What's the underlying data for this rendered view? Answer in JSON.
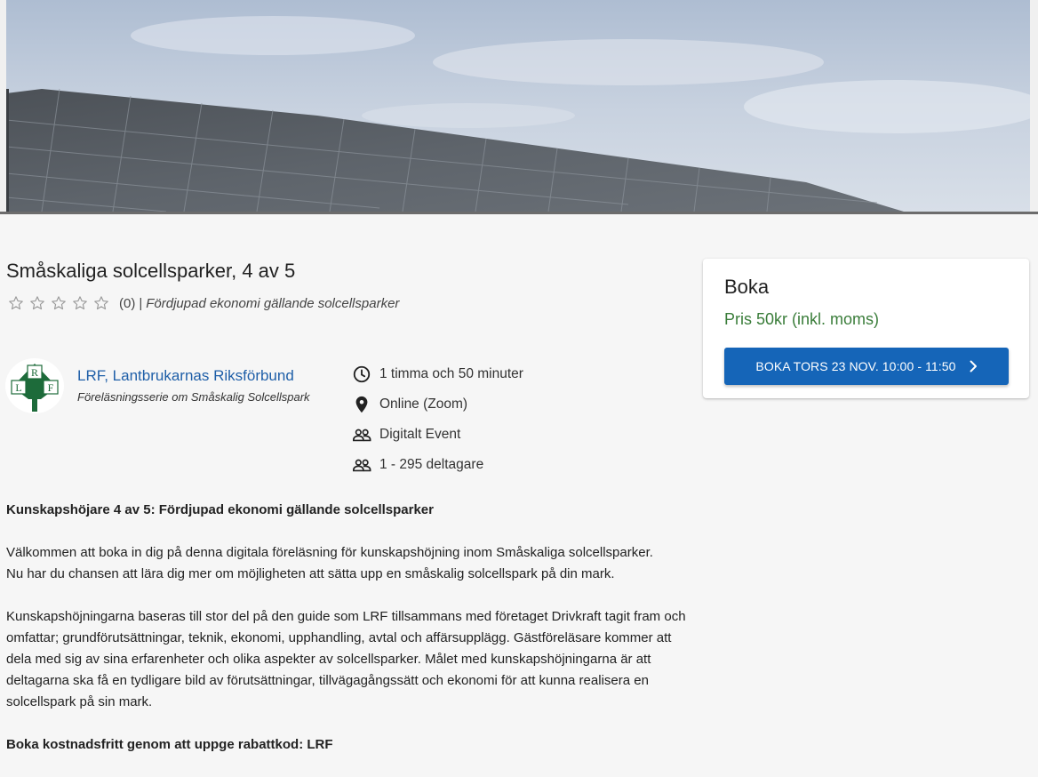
{
  "hero": {
    "image_alt": "solar-panels-roof-image"
  },
  "event": {
    "title": "Småskaliga solcellsparker, 4 av 5",
    "rating": {
      "stars": 0,
      "max_stars": 5,
      "count_text": "(0)",
      "separator": "|"
    },
    "category": "Fördjupad ekonomi gällande solcellsparker"
  },
  "organizer": {
    "name": "LRF, Lantbrukarnas Riksförbund",
    "subtitle": "Föreläsningsserie om Småskalig Solcellspark",
    "logo_letters": [
      "L",
      "R",
      "F"
    ]
  },
  "details": [
    {
      "icon": "clock-icon",
      "text": "1 timma och 50 minuter"
    },
    {
      "icon": "location-pin-icon",
      "text": "Online (Zoom)"
    },
    {
      "icon": "people-icon",
      "text": "Digitalt Event"
    },
    {
      "icon": "people-icon",
      "text": "1 - 295 deltagare"
    }
  ],
  "booking": {
    "title": "Boka",
    "price": "Pris 50kr (inkl. moms)",
    "button_label": "BOKA TORS 23 NOV. 10:00 - 11:50",
    "accent_color": "#1565b8",
    "price_color": "#3a7d3a"
  },
  "description": {
    "heading": "Kunskapshöjare 4 av 5: Fördjupad ekonomi gällande solcellsparker",
    "paragraph1_line1": "Välkommen att boka in dig på denna digitala föreläsning för kunskapshöjning inom Småskaliga solcellsparker.",
    "paragraph1_line2": "Nu har du chansen att lära dig mer om möjligheten att sätta upp en småskalig solcellspark på din mark.",
    "paragraph2": "Kunskapshöjningarna baseras till stor del på den guide som LRF tillsammans med företaget Drivkraft tagit fram och omfattar; grundförutsättningar, teknik, ekonomi, upphandling, avtal och affärsupplägg. Gästföreläsare kommer att dela med sig av sina erfarenheter och olika aspekter av solcellsparker. Målet med kunskapshöjningarna är att deltagarna ska få en tydligare bild av förutsättningar, tillvägagångssätt och ekonomi för att kunna realisera en solcellspark på sin mark.",
    "footer_bold": "Boka kostnadsfritt genom att uppge rabattkod: LRF"
  }
}
